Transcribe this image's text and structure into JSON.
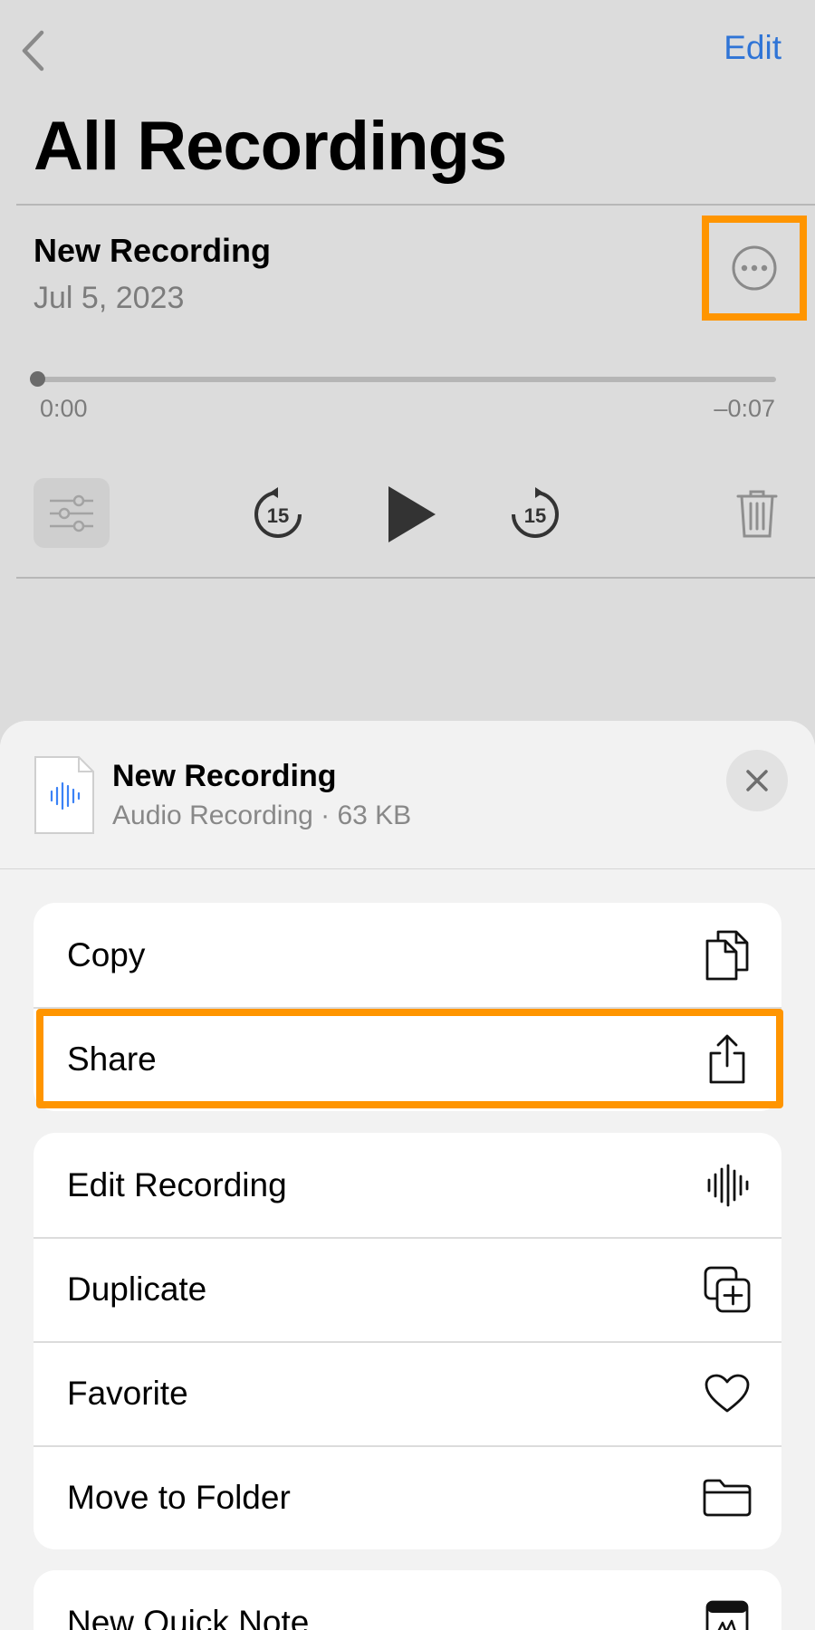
{
  "nav": {
    "edit_label": "Edit",
    "back_icon": "chevron-left-icon"
  },
  "page": {
    "title": "All Recordings"
  },
  "recording": {
    "title": "New Recording",
    "date": "Jul 5, 2023",
    "time_elapsed": "0:00",
    "time_remaining": "–0:07",
    "progress": 0.0,
    "skip_back_seconds": "15",
    "skip_forward_seconds": "15"
  },
  "sheet": {
    "title": "New Recording",
    "subtitle": "Audio Recording · 63 KB",
    "groups": [
      {
        "items": [
          {
            "label": "Copy",
            "icon": "copy-icon"
          },
          {
            "label": "Share",
            "icon": "share-icon"
          }
        ]
      },
      {
        "items": [
          {
            "label": "Edit Recording",
            "icon": "waveform-icon"
          },
          {
            "label": "Duplicate",
            "icon": "duplicate-icon"
          },
          {
            "label": "Favorite",
            "icon": "heart-icon"
          },
          {
            "label": "Move to Folder",
            "icon": "folder-icon"
          }
        ]
      },
      {
        "items": [
          {
            "label": "New Quick Note",
            "icon": "quick-note-icon"
          }
        ]
      }
    ]
  },
  "colors": {
    "accent": "#2f74d6",
    "highlight": "#ff9500",
    "waveform": "#3b82f6"
  }
}
